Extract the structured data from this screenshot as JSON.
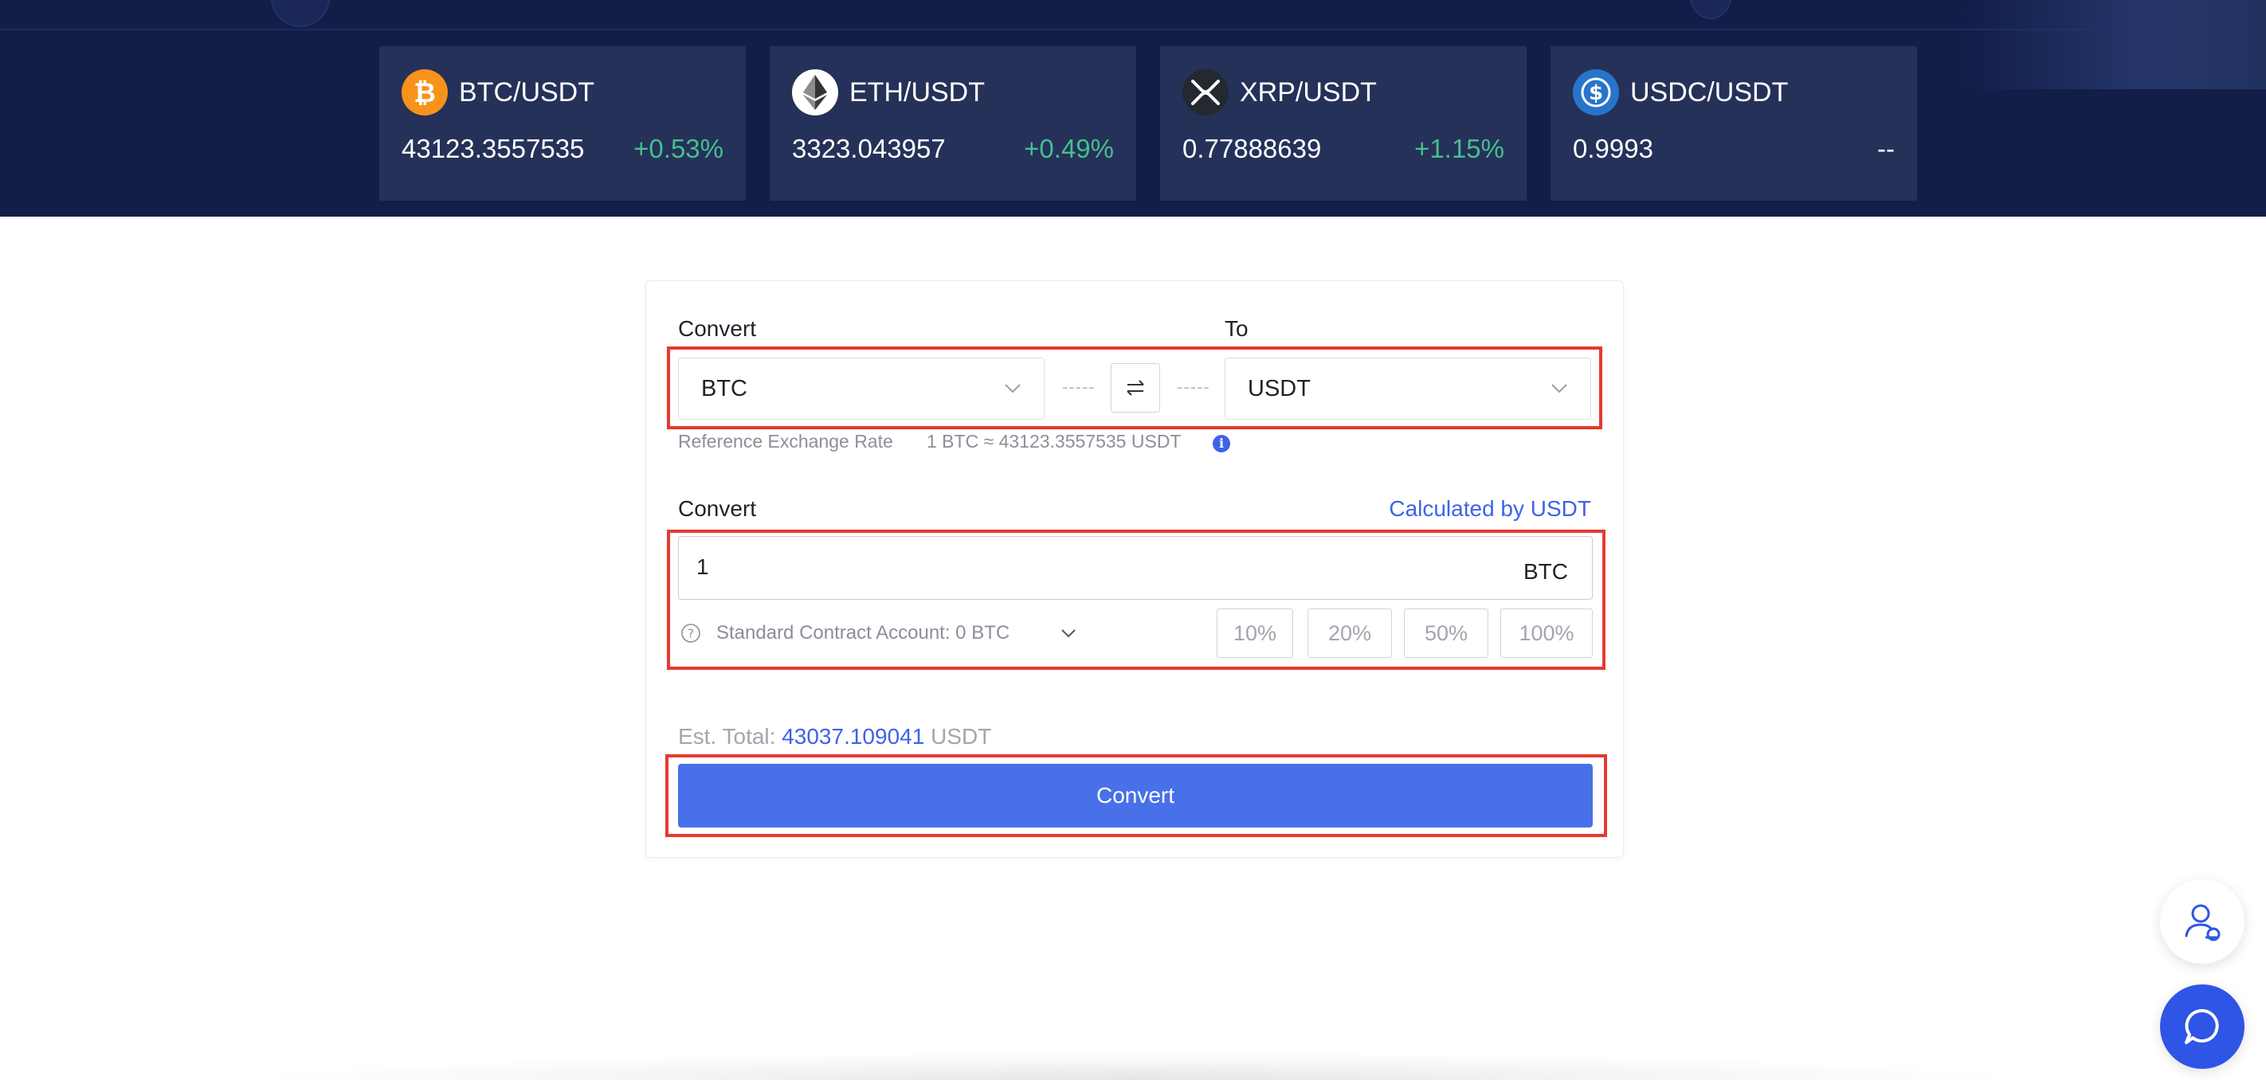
{
  "tickers": [
    {
      "pair": "BTC/USDT",
      "price": "43123.3557535",
      "change": "+0.53%",
      "icon": "bitcoin-icon",
      "color": "#f7931a"
    },
    {
      "pair": "ETH/USDT",
      "price": "3323.043957",
      "change": "+0.49%",
      "icon": "ethereum-icon",
      "color": "#ffffff"
    },
    {
      "pair": "XRP/USDT",
      "price": "0.77888639",
      "change": "+1.15%",
      "icon": "xrp-icon",
      "color": "#23292f"
    },
    {
      "pair": "USDC/USDT",
      "price": "0.9993",
      "change": "--",
      "icon": "usdc-icon",
      "color": "#2775ca"
    }
  ],
  "colors": {
    "banner": "#121e48",
    "ticker_card": "#253158",
    "positive": "#45bf8f",
    "accent": "#3d63e6",
    "button": "#4870e8",
    "highlight": "#e53a2f"
  },
  "converter": {
    "from_label": "Convert",
    "to_label": "To",
    "from_currency": "BTC",
    "to_currency": "USDT",
    "dots": "-----",
    "rate_label": "Reference Exchange Rate",
    "rate_value": "1 BTC ≈ 43123.3557535 USDT",
    "amount_label": "Convert",
    "calc_link": "Calculated by USDT",
    "amount_value": "1",
    "amount_unit": "BTC",
    "account_text": "Standard Contract Account: 0 BTC",
    "percents": [
      "10%",
      "20%",
      "50%",
      "100%"
    ],
    "est_label": "Est. Total:",
    "est_value": "43037.109041",
    "est_currency": "USDT",
    "button_label": "Convert"
  }
}
